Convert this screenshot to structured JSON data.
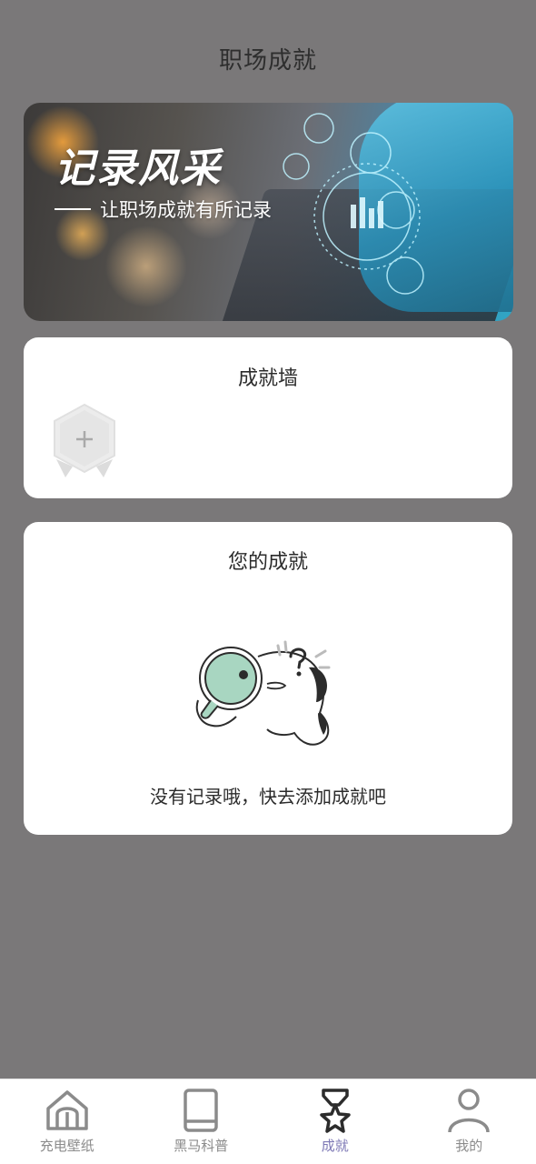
{
  "header": {
    "title": "职场成就"
  },
  "banner": {
    "title": "记录风采",
    "subtitle": "让职场成就有所记录"
  },
  "achievement_wall": {
    "title": "成就墙",
    "add_badge_icon": "plus-icon"
  },
  "your_achievements": {
    "title": "您的成就",
    "empty_text": "没有记录哦，快去添加成就吧",
    "illustration": "magnifier-cartoon"
  },
  "tabbar": {
    "items": [
      {
        "label": "充电壁纸",
        "icon": "home-icon",
        "active": false
      },
      {
        "label": "黑马科普",
        "icon": "book-icon",
        "active": false
      },
      {
        "label": "成就",
        "icon": "medal-icon",
        "active": true
      },
      {
        "label": "我的",
        "icon": "user-icon",
        "active": false
      }
    ]
  },
  "colors": {
    "background": "#7a7879",
    "card": "#ffffff",
    "tab_active": "#7d78b5",
    "tab_inactive": "#8b8b8b",
    "accent_green": "#a8d6c1"
  }
}
